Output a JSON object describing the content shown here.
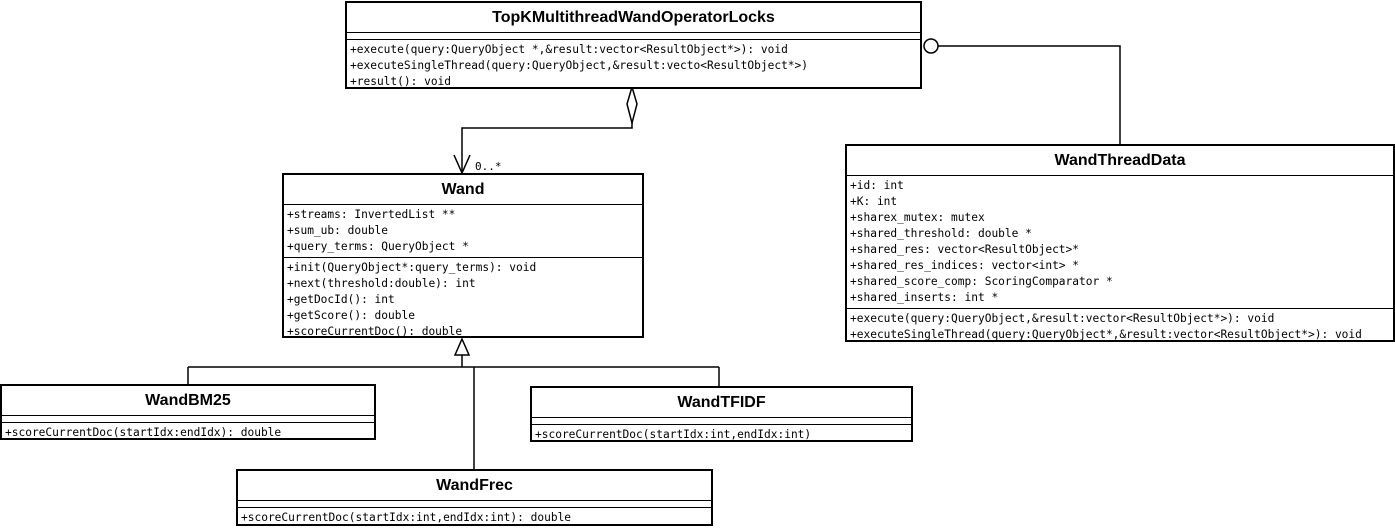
{
  "classes": {
    "topk": {
      "name": "TopKMultithreadWandOperatorLocks",
      "attributes": [],
      "operations": [
        "+execute(query:QueryObject *,&result:vector<ResultObject*>): void",
        "+executeSingleThread(query:QueryObject,&result:vecto<ResultObject*>)",
        "+result(): void"
      ]
    },
    "wandthread": {
      "name": "WandThreadData",
      "attributes": [
        "+id: int",
        "+K: int",
        "+sharex_mutex: mutex",
        "+shared_threshold: double *",
        "+shared_res: vector<ResultObject>*",
        "+shared_res_indices: vector<int> *",
        "+shared_score_comp: ScoringComparator *",
        "+shared_inserts: int *"
      ],
      "operations": [
        "+execute(query:QueryObject,&result:vector<ResultObject*>): void",
        "+executeSingleThread(query:QueryObject*,&result:vector<ResultObject*>): void"
      ]
    },
    "wand": {
      "name": "Wand",
      "attributes": [
        "+streams: InvertedList **",
        "+sum_ub: double",
        "+query_terms: QueryObject *"
      ],
      "operations": [
        "+init(QueryObject*:query_terms): void",
        "+next(threshold:double): int",
        "+getDocId(): int",
        "+getScore(): double",
        "+scoreCurrentDoc(): double"
      ]
    },
    "bm25": {
      "name": "WandBM25",
      "attributes": [],
      "operations": [
        "+scoreCurrentDoc(startIdx:endIdx): double"
      ]
    },
    "tfidf": {
      "name": "WandTFIDF",
      "attributes": [],
      "operations": [
        "+scoreCurrentDoc(startIdx:int,endIdx:int)"
      ]
    },
    "frec": {
      "name": "WandFrec",
      "attributes": [],
      "operations": [
        "+scoreCurrentDoc(startIdx:int,endIdx:int): double"
      ]
    }
  },
  "relations": {
    "aggregation_multiplicity": "0..*"
  }
}
